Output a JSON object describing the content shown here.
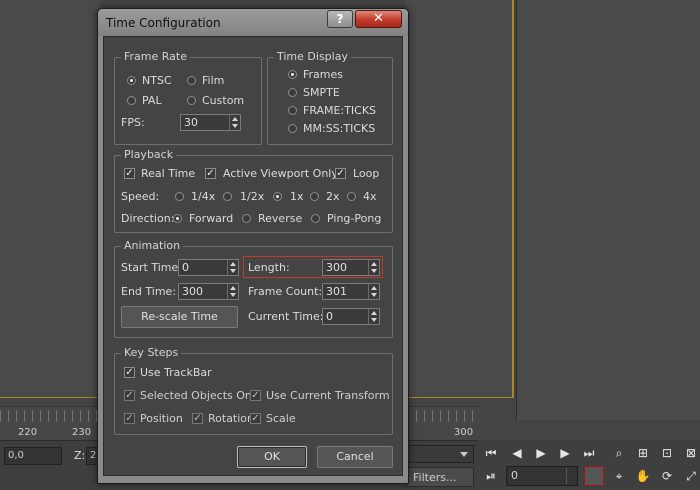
{
  "dialog": {
    "title": "Time Configuration",
    "help_label": "?",
    "close_label": "✕",
    "frame_rate": {
      "title": "Frame Rate",
      "ntsc": "NTSC",
      "film": "Film",
      "pal": "PAL",
      "custom": "Custom",
      "fps_label": "FPS:",
      "fps_value": "30",
      "selected": "NTSC"
    },
    "time_display": {
      "title": "Time Display",
      "frames": "Frames",
      "smpte": "SMPTE",
      "frame_ticks": "FRAME:TICKS",
      "mmss_ticks": "MM:SS:TICKS",
      "selected": "Frames"
    },
    "playback": {
      "title": "Playback",
      "real_time": "Real Time",
      "active_viewport_only": "Active Viewport Only",
      "loop": "Loop",
      "speed_label": "Speed:",
      "speed_quarter": "1/4x",
      "speed_half": "1/2x",
      "speed_1x": "1x",
      "speed_2x": "2x",
      "speed_4x": "4x",
      "speed_selected": "1x",
      "direction_label": "Direction:",
      "forward": "Forward",
      "reverse": "Reverse",
      "ping_pong": "Ping-Pong",
      "direction_selected": "Forward"
    },
    "animation": {
      "title": "Animation",
      "start_time_label": "Start Time:",
      "start_time_value": "0",
      "length_label": "Length:",
      "length_value": "300",
      "end_time_label": "End Time:",
      "end_time_value": "300",
      "frame_count_label": "Frame Count:",
      "frame_count_value": "301",
      "rescale_label": "Re-scale Time",
      "current_time_label": "Current Time:",
      "current_time_value": "0"
    },
    "key_steps": {
      "title": "Key Steps",
      "use_trackbar": "Use TrackBar",
      "selected_objects_only": "Selected Objects Only",
      "use_current_transform": "Use Current Transform",
      "position": "Position",
      "rotation": "Rotation",
      "scale": "Scale"
    },
    "ok_label": "OK",
    "cancel_label": "Cancel"
  },
  "background": {
    "ruler_labels": [
      "220",
      "230",
      "300"
    ],
    "coord_x_value": "0,0",
    "z_label": "Z:",
    "z_value": "2",
    "filters_label": "Filters...",
    "current_frame_value": "0"
  },
  "colors": {
    "ui_background": "#444444",
    "dialog_frame": "#8a8a8a",
    "highlight_red": "#c0392b",
    "viewport_border": "#a8862e"
  }
}
